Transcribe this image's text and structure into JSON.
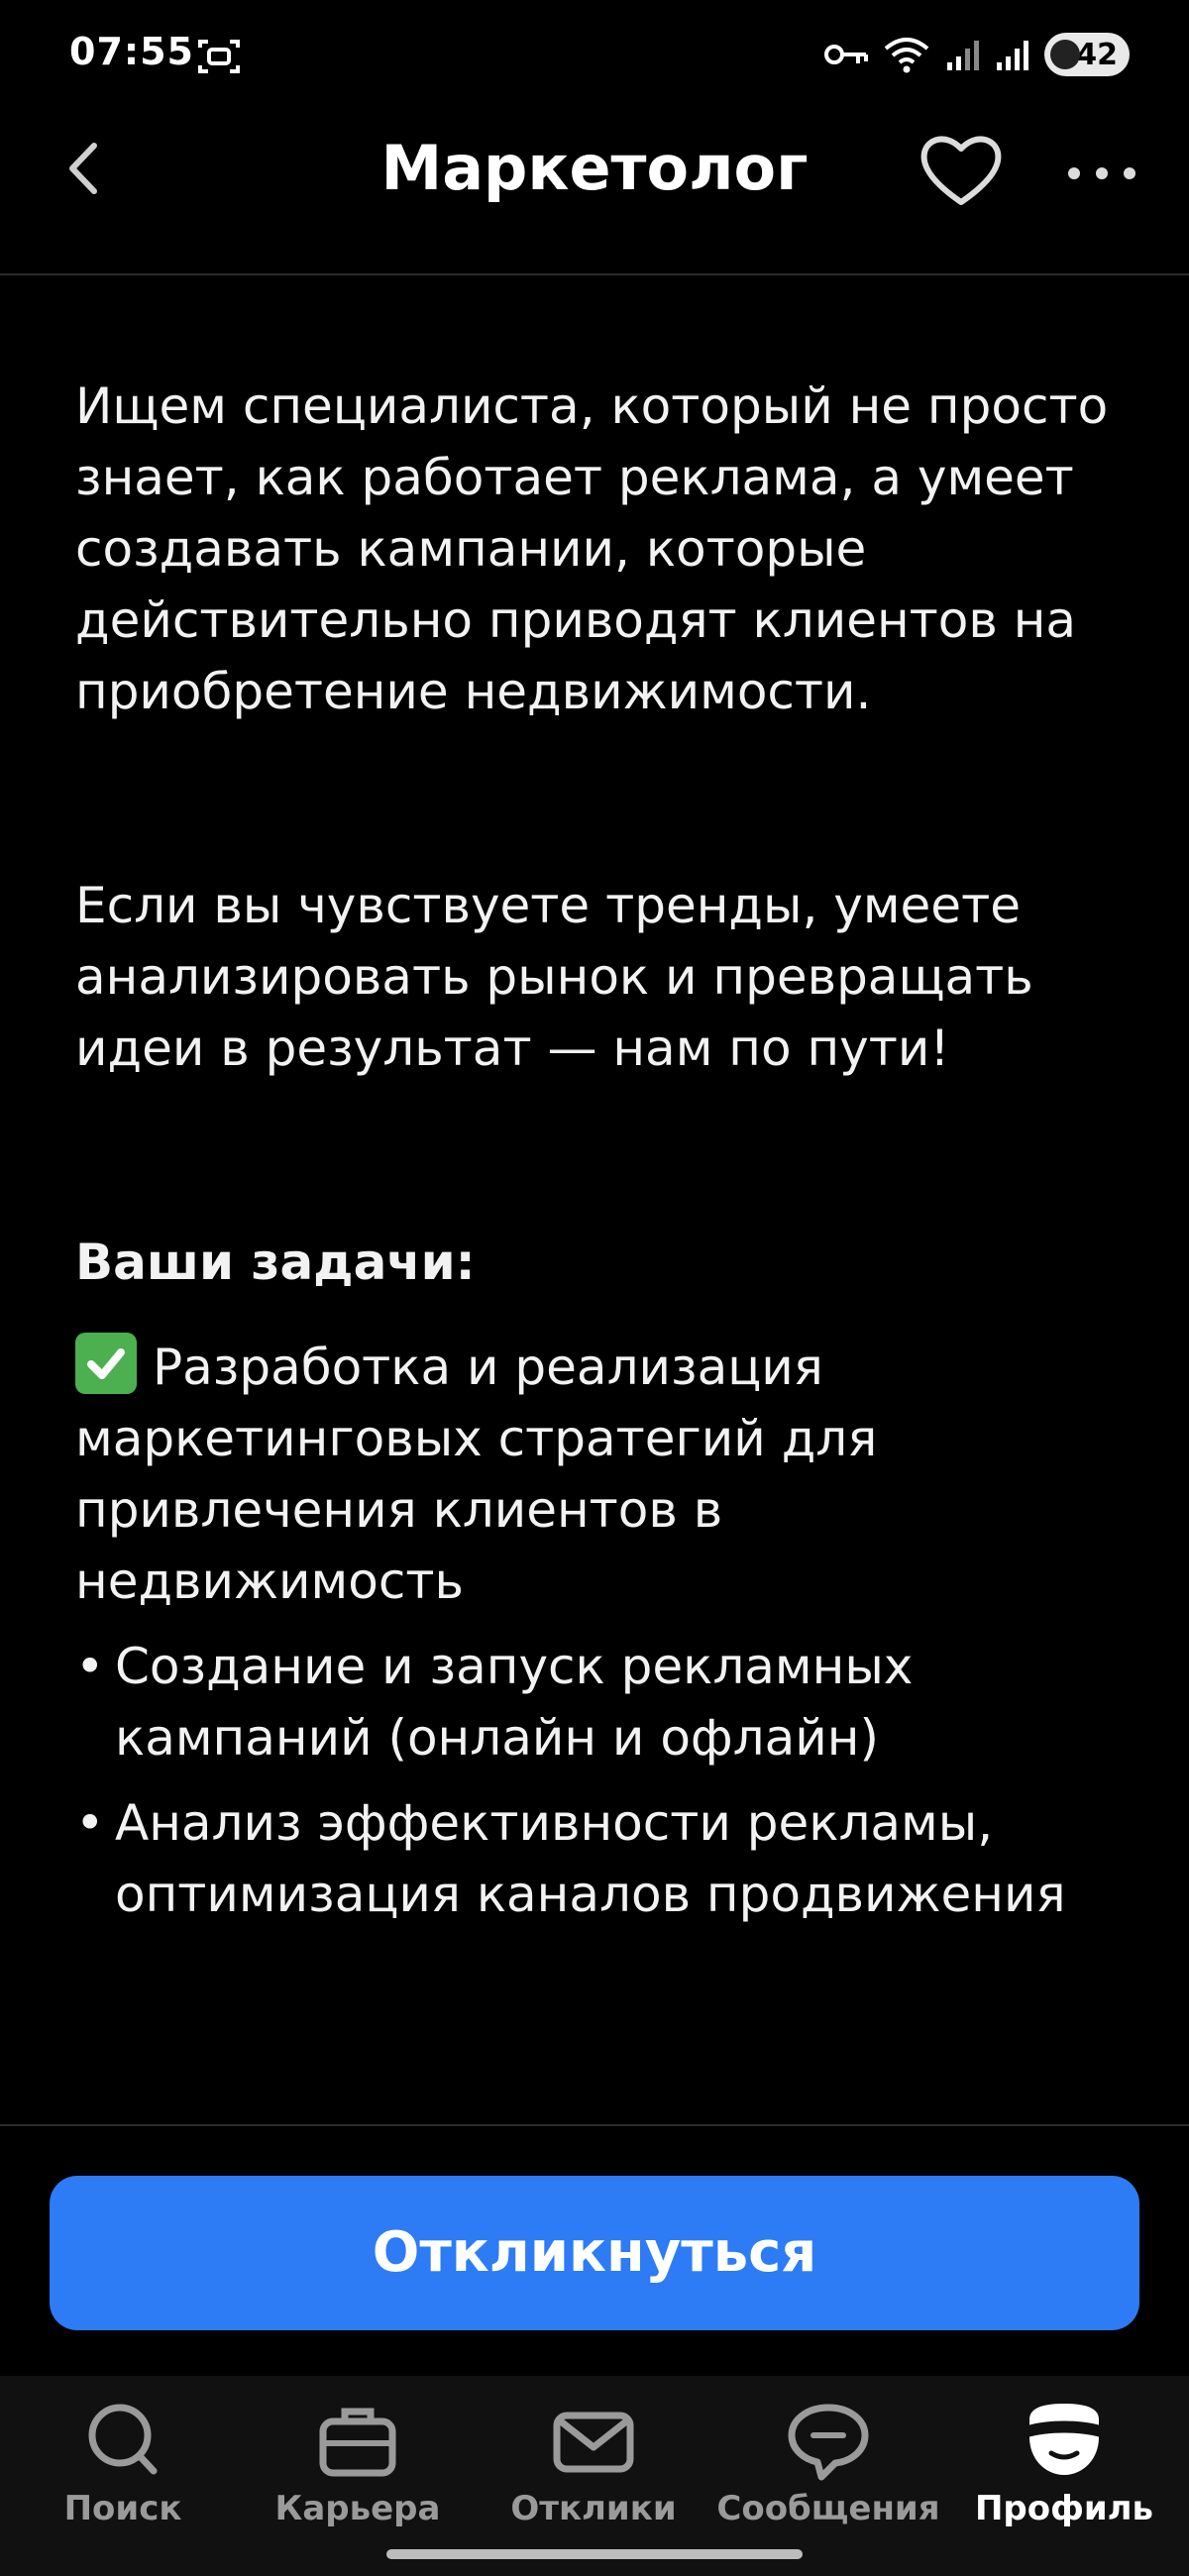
{
  "status_bar": {
    "time": "07:55",
    "battery": "42"
  },
  "header": {
    "title": "Маркетолог"
  },
  "content": {
    "paragraph_1": "Ищем специалиста, который не просто знает, как работает реклама, а умеет создавать кампании, которые действительно приводят клиентов на приобретение недвижимости.",
    "paragraph_2": "Если вы чувствуете тренды, умеете анализировать рынок и превращать идеи в результат — нам по пути!",
    "tasks_heading": "Ваши задачи:",
    "task_1": "Разработка и реализация маркетинговых стратегий для привлечения клиентов в недвижимость",
    "bullets": [
      "Создание и запуск рекламных кампаний (онлайн и офлайн)",
      "Анализ эффективности рекламы, оптимизация каналов продвижения"
    ]
  },
  "apply": {
    "label": "Откликнуться"
  },
  "nav": {
    "items": [
      {
        "label": "Поиск",
        "icon": "search-icon"
      },
      {
        "label": "Карьера",
        "icon": "briefcase-icon"
      },
      {
        "label": "Отклики",
        "icon": "envelope-icon"
      },
      {
        "label": "Сообщения",
        "icon": "chat-icon"
      },
      {
        "label": "Профиль",
        "icon": "profile-icon"
      }
    ],
    "active_index": 4
  },
  "colors": {
    "background": "#000000",
    "accent": "#2d7bf5",
    "check": "#4caf50"
  }
}
